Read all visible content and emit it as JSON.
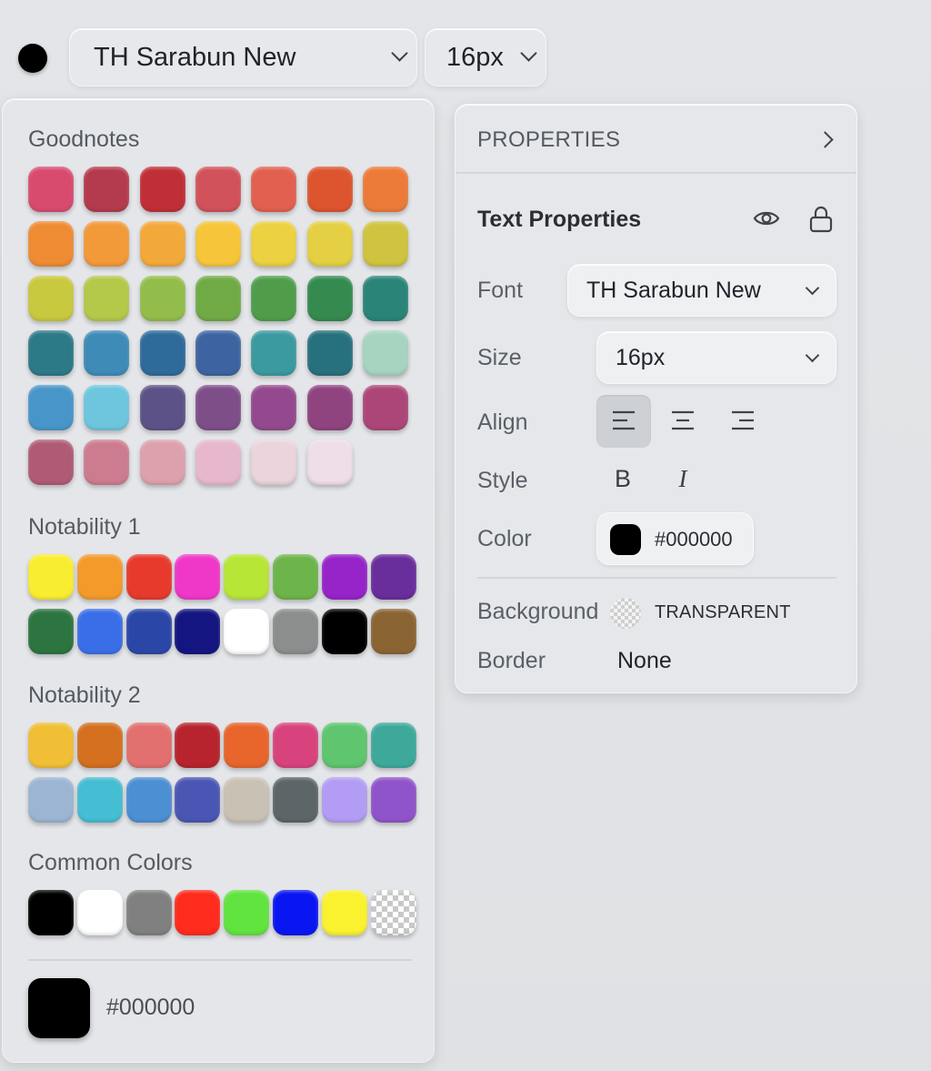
{
  "toolbar": {
    "color": "#000000",
    "font": "TH Sarabun New",
    "size": "16px"
  },
  "palette": {
    "sections": [
      {
        "title": "Goodnotes",
        "colors": [
          "#d94b6e",
          "#b43b4e",
          "#c02f38",
          "#d1525a",
          "#e2604f",
          "#dc552f",
          "#ec7b39",
          "#ee8b33",
          "#f2993a",
          "#f3a83a",
          "#f6c53a",
          "#ecd141",
          "#e4d042",
          "#cfc340",
          "#c9c93f",
          "#b4c84a",
          "#93bd4a",
          "#70aa45",
          "#4f9d4b",
          "#358a4f",
          "#2a8478",
          "#2c7988",
          "#3e8bb8",
          "#2e6b9b",
          "#3d64a0",
          "#3b9aa0",
          "#27717e",
          "#a6d4c0",
          "#4896c9",
          "#6dc6de",
          "#5d5287",
          "#7e4e89",
          "#94498e",
          "#8f437f",
          "#ad4678",
          "#b05b75",
          "#cd7c8f",
          "#dda1ad",
          "#e7b8cd",
          "#ecd4dc",
          "#efdee7"
        ]
      },
      {
        "title": "Notability 1",
        "colors": [
          "#f9ed32",
          "#f39a2a",
          "#e73a2c",
          "#ef37c8",
          "#b7e637",
          "#6db44b",
          "#9624c8",
          "#6a2d9c",
          "#2c7540",
          "#3a6ee8",
          "#2a47a8",
          "#141580",
          "#ffffff",
          "#8c8d8d",
          "#000000",
          "#8b6434"
        ]
      },
      {
        "title": "Notability 2",
        "colors": [
          "#f1bf36",
          "#d4701f",
          "#e2706f",
          "#b7242d",
          "#e8652c",
          "#d8437d",
          "#5fc56e",
          "#3ea99b",
          "#9bb5d2",
          "#45bdd2",
          "#4c8fd3",
          "#4a56b3",
          "#c9c2b4",
          "#5c6567",
          "#b39cf4",
          "#8f54c9"
        ]
      },
      {
        "title": "Common Colors",
        "colors": [
          "#000000",
          "#ffffff",
          "#808080",
          "#ff2b1c",
          "#61e43f",
          "#0a16f2",
          "#faf22f",
          "transparent"
        ]
      }
    ],
    "current": {
      "color": "#000000",
      "hex": "#000000"
    }
  },
  "properties": {
    "header": "PROPERTIES",
    "section": "Text Properties",
    "font_label": "Font",
    "font_value": "TH Sarabun New",
    "size_label": "Size",
    "size_value": "16px",
    "align_label": "Align",
    "style_label": "Style",
    "bold": "B",
    "italic": "I",
    "color_label": "Color",
    "color_value": "#000000",
    "background_label": "Background",
    "background_value": "TRANSPARENT",
    "border_label": "Border",
    "border_value": "None"
  }
}
